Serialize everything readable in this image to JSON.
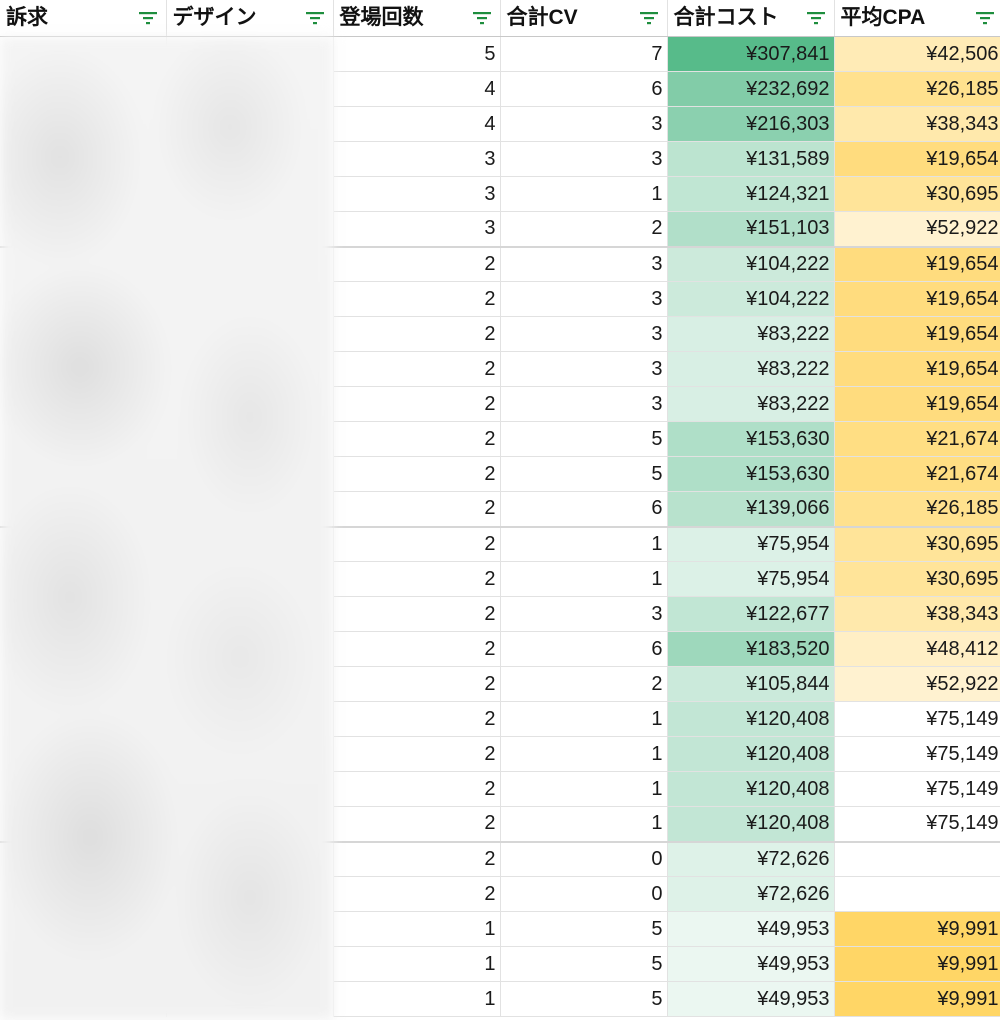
{
  "headers": {
    "appeal": "訴求",
    "design": "デザイン",
    "count": "登場回数",
    "cv": "合計CV",
    "cost": "合計コスト",
    "cpa": "平均CPA"
  },
  "icons": {
    "filter": "filter-icon"
  },
  "colors": {
    "filter_icon": "#1e8e3e",
    "cost_scale_min": "#ffffff",
    "cost_scale_max": "#57bb8a",
    "cpa_scale_low": "#ffd666",
    "cpa_scale_high": "#ffffff"
  },
  "rows": [
    {
      "count": "5",
      "cv": "7",
      "cost": "¥307,841",
      "cost_value": 307841,
      "cpa": "¥42,506",
      "cpa_value": 42506
    },
    {
      "count": "4",
      "cv": "6",
      "cost": "¥232,692",
      "cost_value": 232692,
      "cpa": "¥26,185",
      "cpa_value": 26185
    },
    {
      "count": "4",
      "cv": "3",
      "cost": "¥216,303",
      "cost_value": 216303,
      "cpa": "¥38,343",
      "cpa_value": 38343
    },
    {
      "count": "3",
      "cv": "3",
      "cost": "¥131,589",
      "cost_value": 131589,
      "cpa": "¥19,654",
      "cpa_value": 19654
    },
    {
      "count": "3",
      "cv": "1",
      "cost": "¥124,321",
      "cost_value": 124321,
      "cpa": "¥30,695",
      "cpa_value": 30695
    },
    {
      "count": "3",
      "cv": "2",
      "cost": "¥151,103",
      "cost_value": 151103,
      "cpa": "¥52,922",
      "cpa_value": 52922
    },
    {
      "count": "2",
      "cv": "3",
      "cost": "¥104,222",
      "cost_value": 104222,
      "cpa": "¥19,654",
      "cpa_value": 19654
    },
    {
      "count": "2",
      "cv": "3",
      "cost": "¥104,222",
      "cost_value": 104222,
      "cpa": "¥19,654",
      "cpa_value": 19654
    },
    {
      "count": "2",
      "cv": "3",
      "cost": "¥83,222",
      "cost_value": 83222,
      "cpa": "¥19,654",
      "cpa_value": 19654
    },
    {
      "count": "2",
      "cv": "3",
      "cost": "¥83,222",
      "cost_value": 83222,
      "cpa": "¥19,654",
      "cpa_value": 19654
    },
    {
      "count": "2",
      "cv": "3",
      "cost": "¥83,222",
      "cost_value": 83222,
      "cpa": "¥19,654",
      "cpa_value": 19654
    },
    {
      "count": "2",
      "cv": "5",
      "cost": "¥153,630",
      "cost_value": 153630,
      "cpa": "¥21,674",
      "cpa_value": 21674
    },
    {
      "count": "2",
      "cv": "5",
      "cost": "¥153,630",
      "cost_value": 153630,
      "cpa": "¥21,674",
      "cpa_value": 21674
    },
    {
      "count": "2",
      "cv": "6",
      "cost": "¥139,066",
      "cost_value": 139066,
      "cpa": "¥26,185",
      "cpa_value": 26185
    },
    {
      "count": "2",
      "cv": "1",
      "cost": "¥75,954",
      "cost_value": 75954,
      "cpa": "¥30,695",
      "cpa_value": 30695
    },
    {
      "count": "2",
      "cv": "1",
      "cost": "¥75,954",
      "cost_value": 75954,
      "cpa": "¥30,695",
      "cpa_value": 30695
    },
    {
      "count": "2",
      "cv": "3",
      "cost": "¥122,677",
      "cost_value": 122677,
      "cpa": "¥38,343",
      "cpa_value": 38343
    },
    {
      "count": "2",
      "cv": "6",
      "cost": "¥183,520",
      "cost_value": 183520,
      "cpa": "¥48,412",
      "cpa_value": 48412
    },
    {
      "count": "2",
      "cv": "2",
      "cost": "¥105,844",
      "cost_value": 105844,
      "cpa": "¥52,922",
      "cpa_value": 52922
    },
    {
      "count": "2",
      "cv": "1",
      "cost": "¥120,408",
      "cost_value": 120408,
      "cpa": "¥75,149",
      "cpa_value": 75149
    },
    {
      "count": "2",
      "cv": "1",
      "cost": "¥120,408",
      "cost_value": 120408,
      "cpa": "¥75,149",
      "cpa_value": 75149
    },
    {
      "count": "2",
      "cv": "1",
      "cost": "¥120,408",
      "cost_value": 120408,
      "cpa": "¥75,149",
      "cpa_value": 75149
    },
    {
      "count": "2",
      "cv": "1",
      "cost": "¥120,408",
      "cost_value": 120408,
      "cpa": "¥75,149",
      "cpa_value": 75149
    },
    {
      "count": "2",
      "cv": "0",
      "cost": "¥72,626",
      "cost_value": 72626,
      "cpa": "",
      "cpa_value": null
    },
    {
      "count": "2",
      "cv": "0",
      "cost": "¥72,626",
      "cost_value": 72626,
      "cpa": "",
      "cpa_value": null
    },
    {
      "count": "1",
      "cv": "5",
      "cost": "¥49,953",
      "cost_value": 49953,
      "cpa": "¥9,991",
      "cpa_value": 9991
    },
    {
      "count": "1",
      "cv": "5",
      "cost": "¥49,953",
      "cost_value": 49953,
      "cpa": "¥9,991",
      "cpa_value": 9991
    },
    {
      "count": "1",
      "cv": "5",
      "cost": "¥49,953",
      "cost_value": 49953,
      "cpa": "¥9,991",
      "cpa_value": 9991
    }
  ]
}
